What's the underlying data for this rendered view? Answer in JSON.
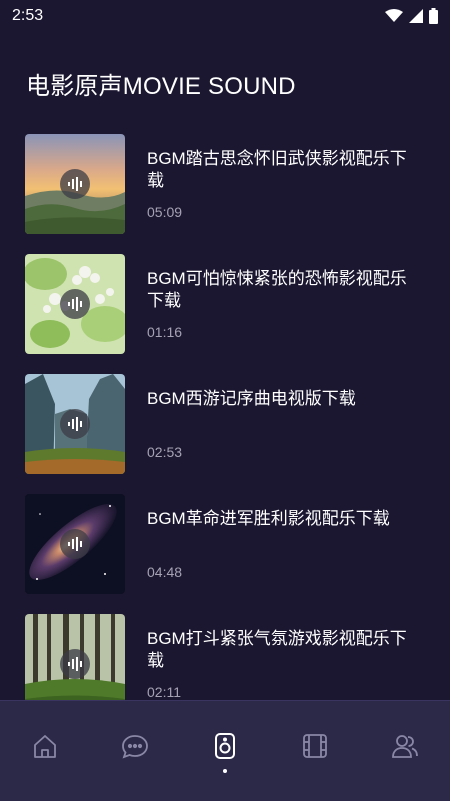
{
  "status_bar": {
    "time": "2:53"
  },
  "page": {
    "title": "电影原声MOVIE SOUND"
  },
  "items": [
    {
      "title": "BGM踏古思念怀旧武侠影视配乐下载",
      "duration": "05:09"
    },
    {
      "title": "BGM可怕惊悚紧张的恐怖影视配乐下载",
      "duration": "01:16"
    },
    {
      "title": "BGM西游记序曲电视版下载",
      "duration": "02:53"
    },
    {
      "title": "BGM革命进军胜利影视配乐下载",
      "duration": "04:48"
    },
    {
      "title": "BGM打斗紧张气氛游戏影视配乐下载",
      "duration": "02:11"
    }
  ],
  "nav": [
    "home-icon",
    "chat-icon",
    "music-speaker-icon",
    "film-icon",
    "users-icon"
  ],
  "colors": {
    "background": "#1c1730",
    "nav_background": "#2b2848",
    "muted_text": "#a6a2b4"
  }
}
